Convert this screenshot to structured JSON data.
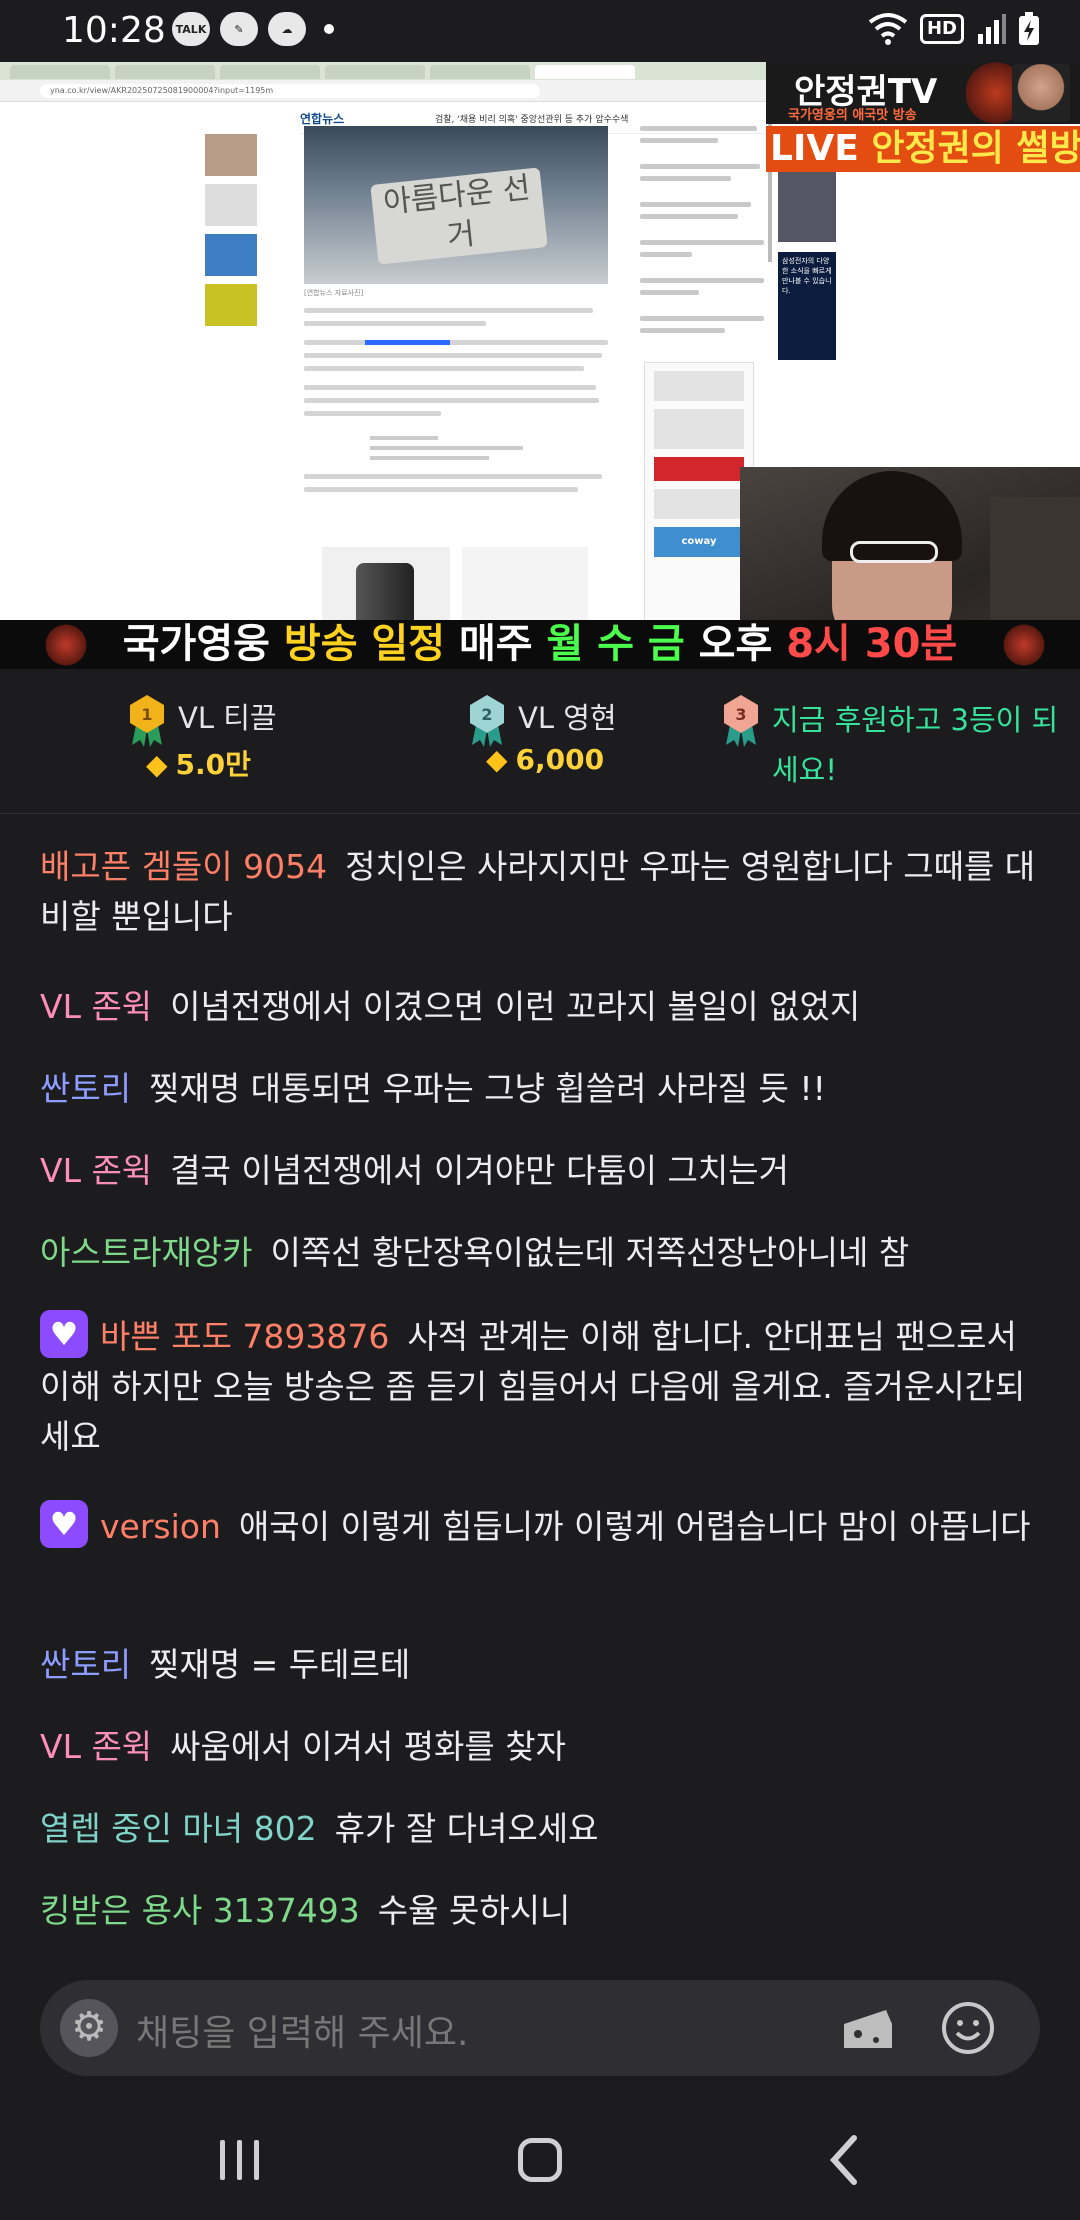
{
  "status_bar": {
    "time": "10:28",
    "notif_icons": [
      "talk-icon",
      "feather-icon",
      "cloud-icon"
    ],
    "hd_label": "HD"
  },
  "video": {
    "browser_url": "yna.co.kr/view/AKR20250725081900004?input=1195m",
    "site_logo": "연합뉴스",
    "site_headline": "검찰, '채용 비리 의혹' 중앙선관위 등 추가 압수수색",
    "sign_text": "아름다운 선거",
    "image_caption": "[연합뉴스 자료사진]",
    "ad_brand": "coway",
    "samsung_ad_text": "삼성전자의 다양한 소식을 빠르게 만나볼 수 있습니다.",
    "overlay_title": "안정권TV",
    "overlay_subtitle": "국가영웅의 애국맛 방송",
    "live_prefix": "LIVE ",
    "live_title": "안정권의 썰방"
  },
  "ticker": {
    "part1": "국가영웅 ",
    "part2": "방송 일정 ",
    "part3": "매주 ",
    "part4": "월 수 금 ",
    "part5": "오후 ",
    "part6": "8시 30분"
  },
  "ranking": [
    {
      "rank": "1",
      "name": "VL 티끌",
      "amount": "5.0만",
      "medal_color": "#f2b21a"
    },
    {
      "rank": "2",
      "name": "VL 영현",
      "amount": "6,000",
      "medal_color": "#7fb8b8"
    },
    {
      "rank": "3",
      "text": "지금 후원하고 3등이 되세요!",
      "medal_color": "#e0735e"
    }
  ],
  "chat": [
    {
      "nick": "배고픈 겜돌이 9054",
      "nick_color": "#ff7f67",
      "text": "정치인은 사라지지만 우파는 영원합니다 그때를 대비할 뿐입니다",
      "badge": false
    },
    {
      "nick": "VL 존윅",
      "nick_color": "#ff8fb8",
      "text": "이념전쟁에서 이겼으면 이런 꼬라지 볼일이 없었지",
      "badge": false
    },
    {
      "nick": "싼토리",
      "nick_color": "#8c9cff",
      "text": "찢재명 대통되면 우파는 그냥 휩쓸려 사라질 듯 !!",
      "badge": false
    },
    {
      "nick": "VL 존윅",
      "nick_color": "#ff8fb8",
      "text": "결국 이념전쟁에서 이겨야만 다툼이 그치는거",
      "badge": false
    },
    {
      "nick": "아스트라재앙카",
      "nick_color": "#7fd98a",
      "text": "이쪽선 황단장욕이없는데 저쪽선장난아니네 참",
      "badge": false
    },
    {
      "nick": "바쁜 포도 7893876",
      "nick_color": "#ff7f67",
      "text": "사적 관계는 이해 합니다. 안대표님 팬으로서 이해 하지만 오늘 방송은 좀 듣기 힘들어서 다음에 올게요. 즐거운시간되세요",
      "badge": true
    },
    {
      "nick": "version",
      "nick_color": "#ff7f67",
      "text": "애국이 이렇게 힘듭니까 이렇게 어렵습니다 맘이 아픕니다",
      "badge": true
    },
    {
      "nick": "싼토리",
      "nick_color": "#8c9cff",
      "text": "찢재명 = 두테르테",
      "badge": false
    },
    {
      "nick": "VL 존윅",
      "nick_color": "#ff8fb8",
      "text": "싸움에서 이겨서 평화를 찾자",
      "badge": false
    },
    {
      "nick": "열렙 중인 마녀 802",
      "nick_color": "#7fd3c8",
      "text": "휴가 잘 다녀오세요",
      "badge": false
    },
    {
      "nick": "킹받은 용사 3137493",
      "nick_color": "#7fd98a",
      "text": "수율 못하시니",
      "badge": false
    }
  ],
  "input": {
    "placeholder": "채팅을 입력해 주세요."
  }
}
